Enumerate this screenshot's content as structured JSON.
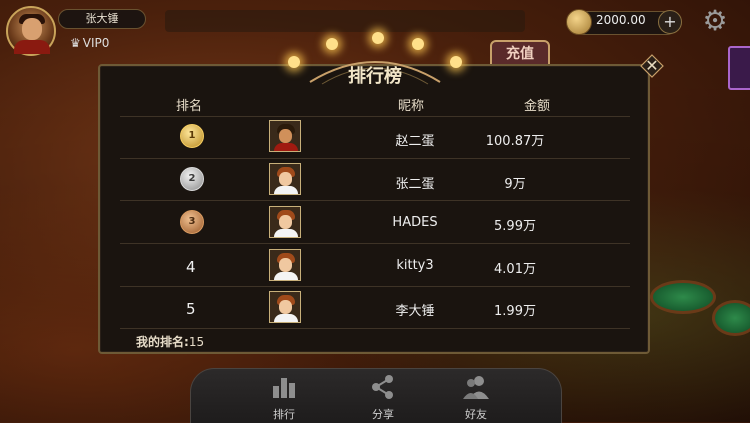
{
  "player": {
    "name": "张大锤",
    "vip": "VIP0"
  },
  "coins": {
    "amount": "2000.00"
  },
  "recharge_label": "充值",
  "panel": {
    "title": "排行榜",
    "headers": {
      "rank": "排名",
      "nickname": "昵称",
      "amount": "金额"
    },
    "rows": [
      {
        "rank": "1",
        "medal": "gold",
        "nickname": "赵二蛋",
        "amount": "100.87万"
      },
      {
        "rank": "2",
        "medal": "silver",
        "nickname": "张二蛋",
        "amount": "9万"
      },
      {
        "rank": "3",
        "medal": "bronze",
        "nickname": "HADES",
        "amount": "5.99万"
      },
      {
        "rank": "4",
        "medal": "",
        "nickname": "kitty3",
        "amount": "4.01万"
      },
      {
        "rank": "5",
        "medal": "",
        "nickname": "李大锤",
        "amount": "1.99万"
      }
    ],
    "my_rank_label": "我的排名:",
    "my_rank_value": "15"
  },
  "nav": {
    "rank_label": "排行",
    "share_label": "分享",
    "friends_label": "好友"
  },
  "icons": [
    "settings-gear-icon",
    "plus-icon",
    "coin-icon",
    "close-icon",
    "crown-icon",
    "bar-chart-icon",
    "share-icon",
    "friends-icon"
  ]
}
